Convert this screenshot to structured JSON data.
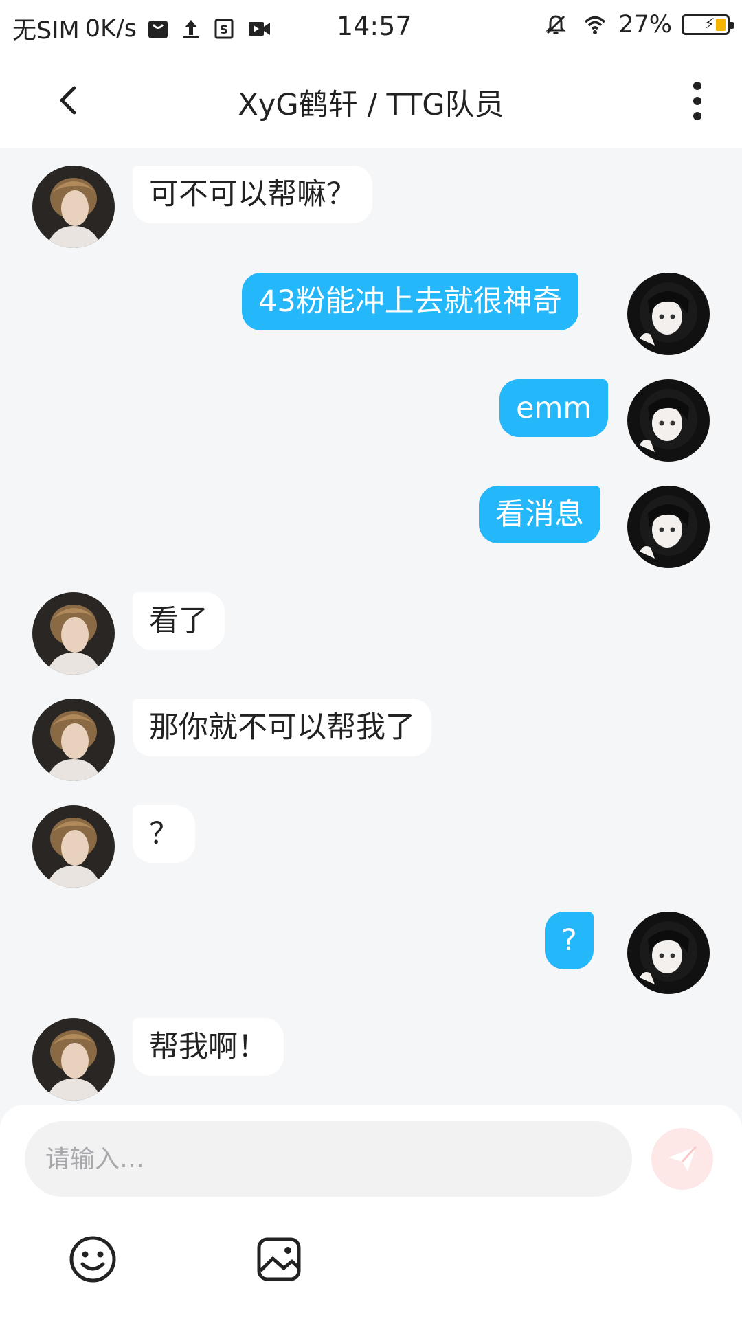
{
  "status_bar": {
    "sim": "无SIM",
    "speed": "0K/s",
    "time": "14:57",
    "battery": "27%"
  },
  "header": {
    "title": "XyG鹤轩 / TTG队员"
  },
  "messages": [
    {
      "side": "left",
      "text": "可不可以帮嘛？"
    },
    {
      "side": "right",
      "text": "43粉能冲上去就很神奇"
    },
    {
      "side": "right",
      "text": "emm"
    },
    {
      "side": "right",
      "text": "看消息"
    },
    {
      "side": "left",
      "text": "看了"
    },
    {
      "side": "left",
      "text": "那你就不可以帮我了"
    },
    {
      "side": "left",
      "text": "？"
    },
    {
      "side": "right",
      "text": "?"
    },
    {
      "side": "left",
      "text": "帮我啊！"
    }
  ],
  "composer": {
    "placeholder": "请输入…"
  },
  "icons": {
    "back": "chevron-left-icon",
    "more": "more-vertical-icon",
    "send": "send-icon",
    "emoji": "emoji-icon",
    "image": "image-icon"
  },
  "colors": {
    "outgoing_bubble": "#24b7fa",
    "incoming_bubble": "#ffffff",
    "background": "#f5f6f8",
    "send_button": "#fde7e7"
  }
}
